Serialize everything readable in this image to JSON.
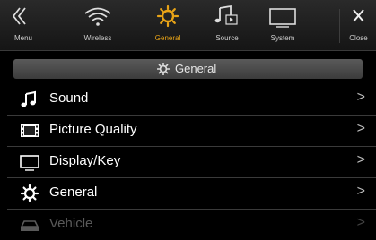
{
  "topbar": {
    "tabs": [
      {
        "label": "Menu",
        "icon": "double-chevron-left-icon"
      },
      {
        "label": "Wireless",
        "icon": "wifi-icon"
      },
      {
        "label": "General",
        "icon": "gear-icon",
        "active": true
      },
      {
        "label": "Source",
        "icon": "music-note-icon"
      },
      {
        "label": "System",
        "icon": "monitor-icon"
      },
      {
        "label": "Close",
        "icon": "close-icon"
      }
    ]
  },
  "header": {
    "title": "General",
    "icon": "gear-icon"
  },
  "items": [
    {
      "label": "Sound",
      "icon": "music-note-icon"
    },
    {
      "label": "Picture Quality",
      "icon": "film-icon"
    },
    {
      "label": "Display/Key",
      "icon": "monitor-icon"
    },
    {
      "label": "General",
      "icon": "gear-icon"
    },
    {
      "label": "Vehicle",
      "icon": "car-icon"
    }
  ],
  "colors": {
    "accent": "#e8a317",
    "background": "#000000"
  }
}
